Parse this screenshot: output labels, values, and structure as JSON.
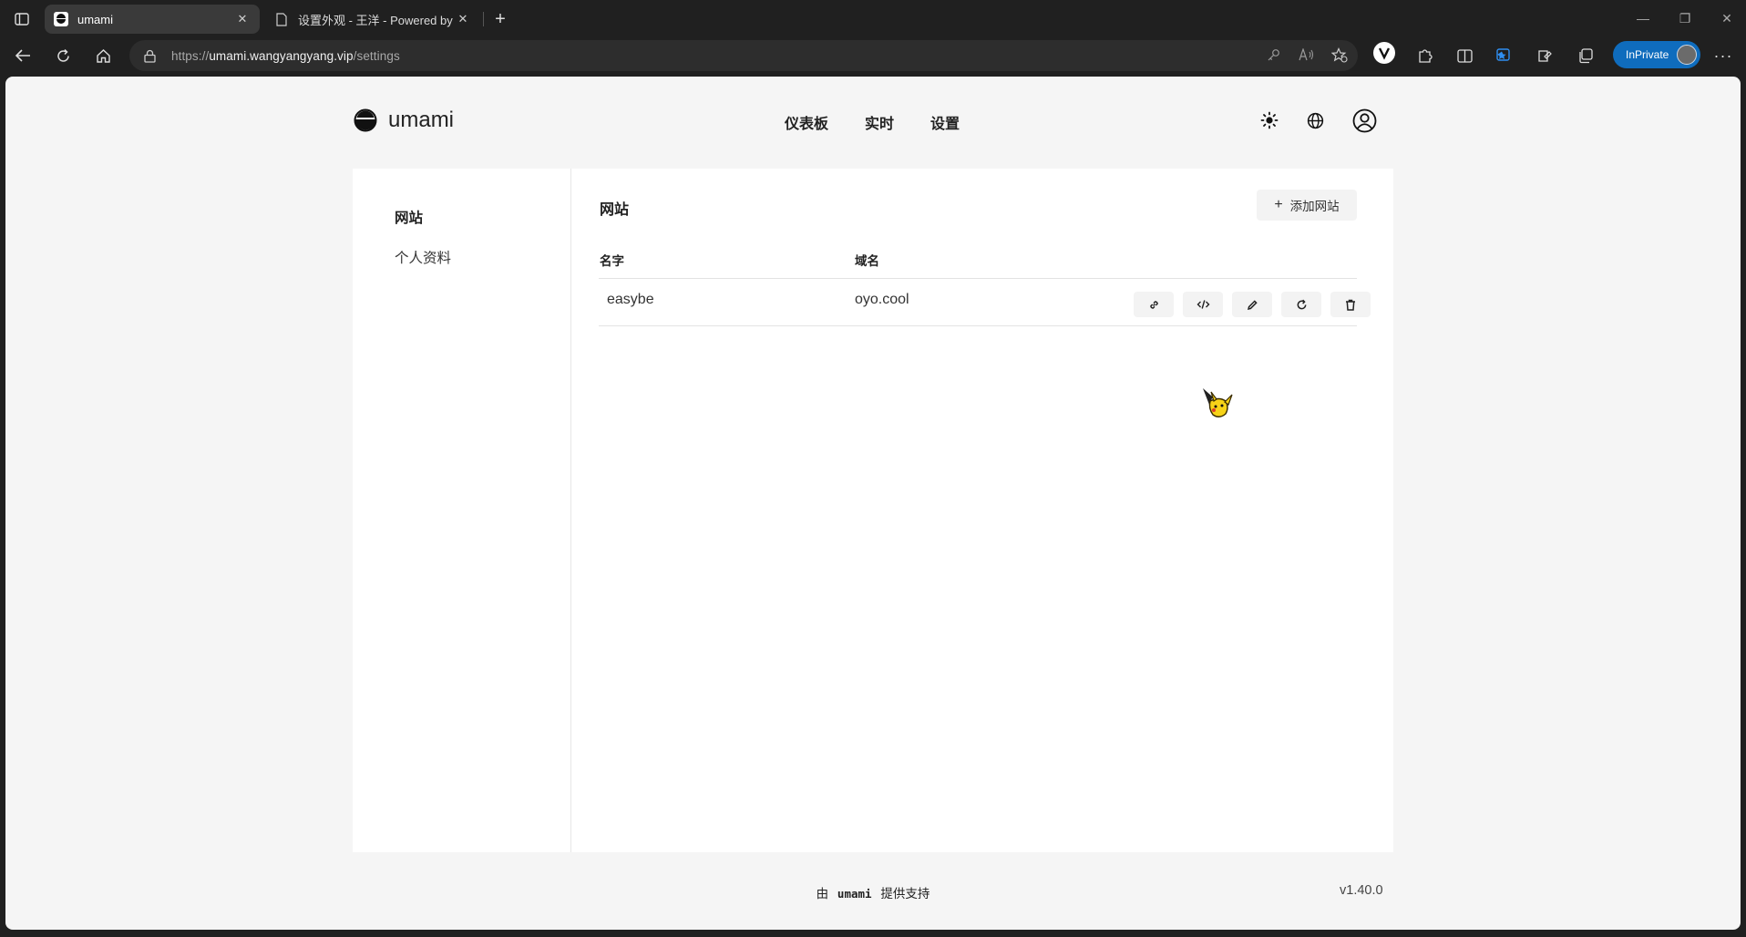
{
  "browser": {
    "tabs": [
      {
        "title": "umami",
        "active": true,
        "favicon": "umami-favicon-icon"
      },
      {
        "title": "设置外观 - 王洋 - Powered by Ty",
        "active": false,
        "favicon": "page-icon"
      }
    ],
    "url": {
      "scheme": "https://",
      "host": "umami.wangyangyang.vip",
      "path": "/settings"
    },
    "inprivate_label": "InPrivate",
    "accent": "#0f6cbd"
  },
  "app": {
    "name": "umami",
    "nav": [
      "仪表板",
      "实时",
      "设置"
    ],
    "header_icons": [
      "sun-icon",
      "globe-icon",
      "user-profile-icon"
    ]
  },
  "sidebar": {
    "items": [
      {
        "label": "网站",
        "active": true
      },
      {
        "label": "个人资料",
        "active": false
      }
    ]
  },
  "content": {
    "title": "网站",
    "add_button": "添加网站",
    "table": {
      "columns": [
        "名字",
        "域名"
      ],
      "rows": [
        {
          "name": "easybe",
          "domain": "oyo.cool",
          "actions": [
            "link-icon",
            "code-icon",
            "edit-icon",
            "reset-icon",
            "trash-icon"
          ]
        }
      ]
    }
  },
  "footer": {
    "prefix": "由",
    "brand": "umami",
    "suffix": "提供支持",
    "version": "v1.40.0"
  }
}
